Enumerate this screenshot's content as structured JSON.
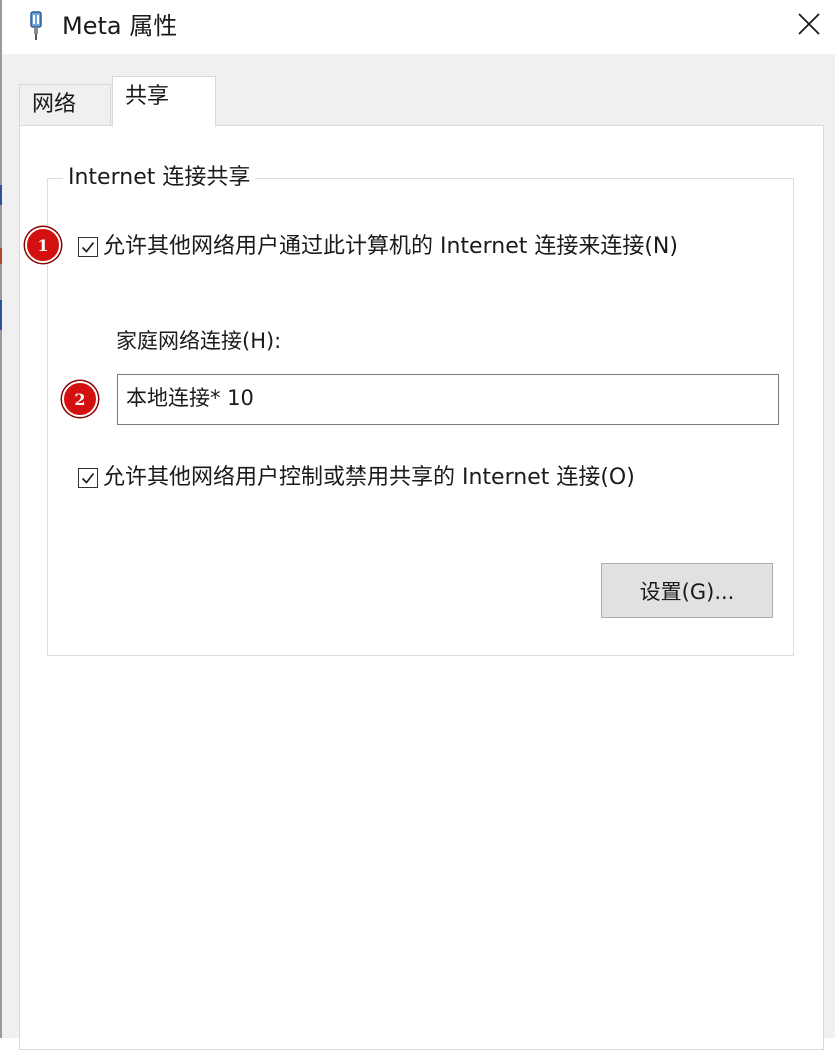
{
  "window": {
    "title": "Meta 属性",
    "icon": "network-adapter-icon",
    "close_icon": "close-icon"
  },
  "tabs": [
    {
      "label": "网络",
      "selected": false
    },
    {
      "label": "共享",
      "selected": true
    }
  ],
  "group": {
    "legend": "Internet 连接共享",
    "allow_share": {
      "label": "允许其他网络用户通过此计算机的 Internet 连接来连接(N)",
      "checked": true
    },
    "home_network": {
      "label": "家庭网络连接(H):",
      "value": "本地连接* 10"
    },
    "allow_control": {
      "label": "允许其他网络用户控制或禁用共享的 Internet 连接(O)",
      "checked": true
    },
    "settings_button": "设置(G)..."
  },
  "annotations": [
    {
      "number": "1",
      "color": "#d40f0f"
    },
    {
      "number": "2",
      "color": "#d40f0f"
    }
  ]
}
